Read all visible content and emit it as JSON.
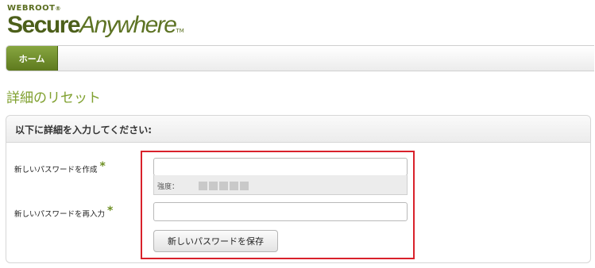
{
  "logo": {
    "small": "WEBROOT",
    "reg": "®",
    "secure": "Secure",
    "anywhere": "Anywhere",
    "tm": "TM"
  },
  "nav": {
    "home": "ホーム"
  },
  "page": {
    "title": "詳細のリセット"
  },
  "form": {
    "header": "以下に詳細を入力してください:",
    "new_password_label": "新しいパスワードを作成",
    "confirm_password_label": "新しいパスワードを再入力",
    "required_mark": "*",
    "new_password_value": "",
    "confirm_password_value": "",
    "strength_label": "強度：",
    "strength_level": 0,
    "strength_blocks": 5,
    "save_button": "新しいパスワードを保存"
  },
  "colors": {
    "brand": "#5e7a1e",
    "title_green": "#7fa02e",
    "highlight": "#d9212b"
  }
}
